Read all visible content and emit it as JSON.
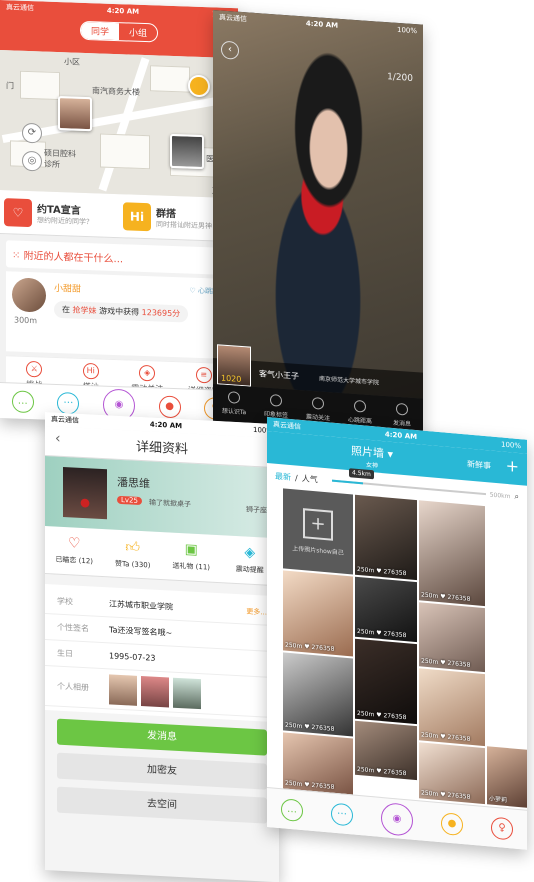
{
  "status": {
    "carrier": "真云通信",
    "time": "4:20 AM",
    "battery": "100%"
  },
  "map_screen": {
    "segments": [
      "同学",
      "小组"
    ],
    "add_label": "+",
    "map_labels": [
      "小区",
      "南汽商务大楼",
      "硕日腔科诊所",
      "医院",
      "芦",
      "门"
    ],
    "actions": [
      {
        "title": "约TA宣言",
        "desc": "想约附近的同学？",
        "icon": "heart-icon",
        "color": "#e94e3c"
      },
      {
        "title": "群搭",
        "desc": "同时搭讪附近男神，女神",
        "icon": "hi-icon",
        "color": "#f6b21f"
      }
    ],
    "nearby_title": "附近的人都在干什么...",
    "feed": {
      "user": "小甜甜",
      "distance": "300m",
      "heart_label": "心跳距离",
      "msg_prefix": "在",
      "msg_game": "抢学妹",
      "msg_mid": "游戏中获得",
      "msg_score": "123695分"
    },
    "feed_ops": [
      "挑战",
      "搭讪",
      "震动关注",
      "详细资料"
    ],
    "tabbar": [
      "chat-icon",
      "share-icon",
      "camera-icon",
      "location-icon",
      "profile-icon"
    ]
  },
  "photo_screen": {
    "counter": "1/200",
    "owner_name": "客气小王子",
    "owner_school": "南京师范大学城市学院",
    "owner_level": "1020",
    "bar_items": [
      "想认识Ta",
      "印象标签",
      "震动关注",
      "心跳距离",
      "发消息"
    ]
  },
  "profile_screen": {
    "title": "详细资料",
    "name": "潘思维",
    "level": "Lv25",
    "status": "输了就掀桌子",
    "place": "狮子座",
    "stats": [
      {
        "label": "已瞄恋 (12)",
        "icon": "heart-outline-icon"
      },
      {
        "label": "赞Ta (330)",
        "icon": "thumb-up-icon"
      },
      {
        "label": "送礼物 (11)",
        "icon": "gift-icon"
      },
      {
        "label": "震动提醒",
        "icon": "vibrate-icon"
      }
    ],
    "rows": [
      {
        "key": "学校",
        "value": "江苏城市职业学院",
        "more": "更多..."
      },
      {
        "key": "个性签名",
        "value": "Ta还没写签名哦~",
        "more": ""
      },
      {
        "key": "生日",
        "value": "1995-07-23",
        "more": ""
      },
      {
        "key": "个人相册",
        "value": "",
        "more": ""
      }
    ],
    "buttons": [
      "发消息",
      "加密友",
      "去空间"
    ]
  },
  "wall_screen": {
    "title": "照片墙",
    "subtitle": "女神",
    "new_label": "新鲜事",
    "add_label": "+",
    "filter_new": "最新",
    "filter_hot": "人气",
    "km_label": "4.5km",
    "km_max": "500km",
    "upload_label": "上传照片show自己",
    "tiles": [
      {
        "meta": "250m  ♥ 276358"
      },
      {
        "meta": "250m  ♥ 276358"
      },
      {
        "meta": "250m  ♥ 276358"
      },
      {
        "meta": "250m  ♥ 276358"
      },
      {
        "meta": "250m  ♥ 276358"
      },
      {
        "meta": "250m  ♥ 276358"
      },
      {
        "meta": "250m  ♥ 276358"
      },
      {
        "meta": "250m  ♥ 276358"
      },
      {
        "meta": "250m  ♥ 276358"
      },
      {
        "meta": "250m  ♥ 276358"
      },
      {
        "meta": "250m  ♥ 276358"
      },
      {
        "meta": "小萝莉"
      }
    ],
    "tabbar": [
      "chat-icon",
      "share-icon",
      "camera-icon",
      "location-icon",
      "profile-icon"
    ]
  }
}
